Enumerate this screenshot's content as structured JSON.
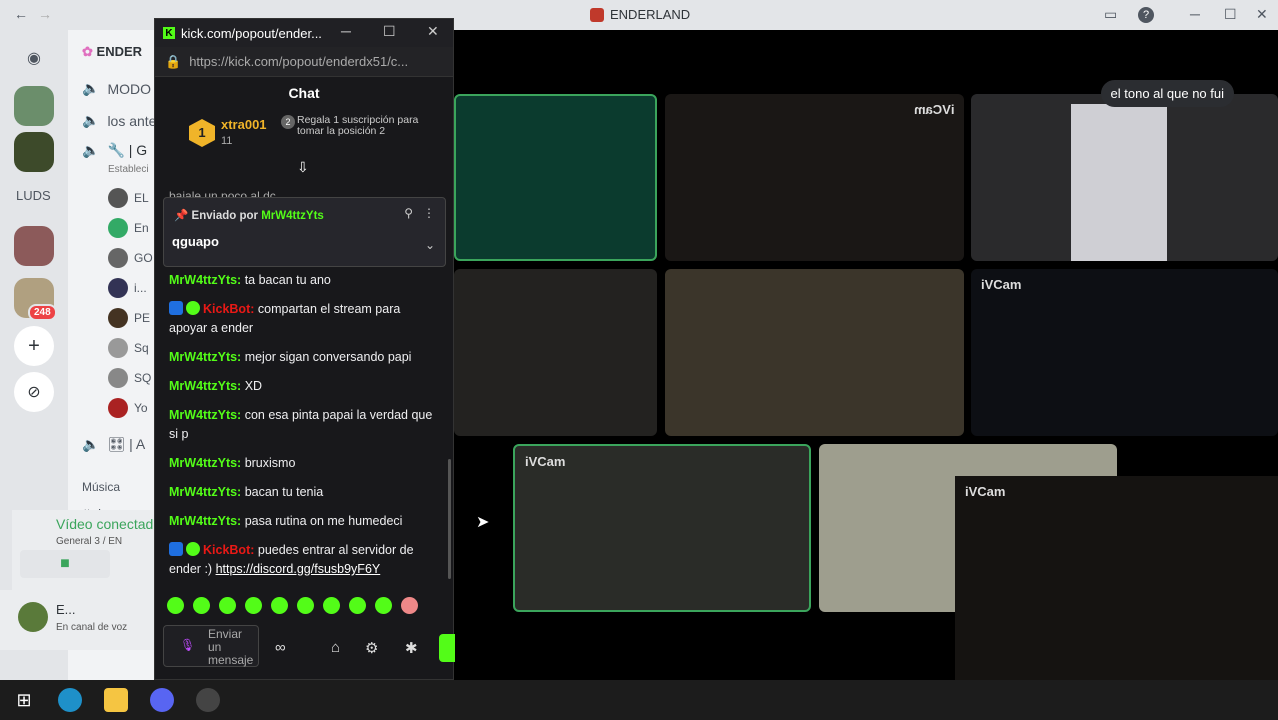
{
  "window": {
    "title": "ENDERLAND",
    "back": "←",
    "forward": "→",
    "icon_inbox": "inbox-icon",
    "icon_help": "?",
    "minimize": "─",
    "maximize": "☐",
    "close": "✕"
  },
  "rail": {
    "home_icon": "discord-icon",
    "folder_label": "LUDS",
    "unread_badge": "248",
    "add_server": "+",
    "explore": "compass-icon"
  },
  "channels": {
    "server_name": "ENDER",
    "items": [
      {
        "label": "MODO",
        "icon": "speaker"
      },
      {
        "label": "los ante",
        "icon": "speaker"
      },
      {
        "label": "🔧 | G",
        "icon": "speaker"
      },
      {
        "label": "Estableci",
        "icon": ""
      }
    ],
    "members": [
      "EL",
      "En",
      "GO",
      "i...",
      "PE",
      "Sq",
      "SQ",
      "Yo"
    ],
    "channel_after": "🎛 | A",
    "category": "Música",
    "text_channel": "| m",
    "voice_status": "Vídeo conectad",
    "voice_sub": "General 3 / EN",
    "user_name": "E...",
    "user_status": "En canal de voz"
  },
  "popout": {
    "title": "kick.com/popout/ender...",
    "url": "https://kick.com/popout/enderdx51/c...",
    "chat_heading": "Chat",
    "leader": {
      "rank": "1",
      "user": "xtra001",
      "count": "11",
      "gift_text": "Regala 1 suscripción para tomar la posición 2"
    },
    "cut_line": "bajale un poco al dc",
    "pinned": {
      "sent_by": "Enviado por",
      "user": "MrW4ttzYts",
      "text": "qguapo"
    },
    "messages": [
      {
        "user": "MrW4ttzYts:",
        "text": " ta bacan tu ano",
        "bot": false
      },
      {
        "user": "KickBot:",
        "text": " compartan el stream para apoyar a ender",
        "bot": true
      },
      {
        "user": "MrW4ttzYts:",
        "text": " mejor sigan conversando papi",
        "bot": false
      },
      {
        "user": "MrW4ttzYts:",
        "text": " XD",
        "bot": false
      },
      {
        "user": "MrW4ttzYts:",
        "text": " con esa pinta papai la verdad que si p",
        "bot": false
      },
      {
        "user": "MrW4ttzYts:",
        "text": " bruxismo",
        "bot": false
      },
      {
        "user": "MrW4ttzYts:",
        "text": " bacan tu tenia",
        "bot": false
      },
      {
        "user": "MrW4ttzYts:",
        "text": " pasa rutina on me humedeci",
        "bot": false
      },
      {
        "user": "KickBot:",
        "text": " puedes entrar al servidor de ender :) ",
        "bot": true,
        "link": "https://discord.gg/fsusb9yF6Y"
      }
    ],
    "composer_placeholder": "Enviar un mensaje",
    "tools": [
      "∞",
      "⌂",
      "⚙",
      "✱"
    ]
  },
  "stage": {
    "speech": "el tono al que no fui",
    "tiles": [
      {
        "tag": ""
      },
      {
        "tag": "iVCam"
      },
      {
        "tag": ""
      },
      {
        "tag": ""
      },
      {
        "tag": ""
      },
      {
        "tag": "iVCam"
      },
      {
        "tag": "iVCam"
      },
      {
        "tag": ""
      },
      {
        "tag": "iVCam"
      }
    ]
  },
  "colors": {
    "kick_green": "#53fc18",
    "discord_green": "#3ba55c",
    "bot_red": "#e91916"
  }
}
